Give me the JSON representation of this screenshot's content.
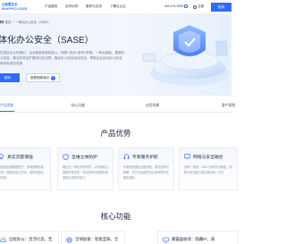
{
  "nav": {
    "logo_line1": "让智慧生长",
    "logo_line2": "INAPPCLOUD",
    "items": [
      {
        "label": "产品服务"
      },
      {
        "label": "合作伙伴"
      },
      {
        "label": "服务与支持"
      },
      {
        "label": "了解云山云"
      }
    ],
    "phone": "400-176-9339",
    "language": "注册",
    "login": "登录"
  },
  "hero": {
    "breadcrumb_home": "首页",
    "breadcrumb_sep": "/",
    "breadcrumb_current": "一体化办公安全（SASE）",
    "title": "体化办公安全（SASE）",
    "description": "在混合办公环境中，企业面临多网络接入、网络+安全+身份+终端，一体化赋能，重塑办公安全，使业务灵活扩展访问无边界，融合办公安全动态安全，帮助企业应对办公安全体系标准化改造",
    "btn_primary": "咨询",
    "btn_secondary": "查看视频演示"
  },
  "tabs": [
    {
      "label": "产品优势",
      "active": true
    },
    {
      "label": "核心功能",
      "active": false
    },
    {
      "label": "应用场景",
      "active": false
    },
    {
      "label": "客户案例",
      "active": false
    }
  ],
  "advantages": {
    "title": "产品优势",
    "cards": [
      {
        "icon": "bulb-icon",
        "title": "真实流量增强",
        "desc": "高品质加速通道提升，多地部署负载分流，降低延迟与抖动，保障关键业务体验"
      },
      {
        "icon": "shield-icon",
        "title": "全维立体防护",
        "desc": "端边云一体化协同防护，从终端到云端提供零信任、安全检测与数据防泄露等立体防护能力"
      },
      {
        "icon": "headset-icon",
        "title": "专家服务护航",
        "desc": "专家服务团队全程护航，提供咨询与部署、交付与运维的全生命周期专业服务保障"
      },
      {
        "icon": "network-icon",
        "title": "网络与安全融合",
        "desc": "全球一张网，1500+全球节点覆盖，网络与安全能力原生融合统一交付"
      }
    ]
  },
  "core": {
    "title": "核心功能",
    "cards": [
      {
        "icon": "cloud-icon",
        "title": "远程办公：灵活引流，无"
      },
      {
        "icon": "globe-icon",
        "title": "全球加速：智能互联，全"
      },
      {
        "icon": "screen-icon",
        "title": "暴露面收敛：隐藏IP，减"
      }
    ]
  },
  "colors": {
    "accent": "#2f6bff",
    "text_dark": "#1a2540",
    "text_muted": "#8a93a6"
  }
}
